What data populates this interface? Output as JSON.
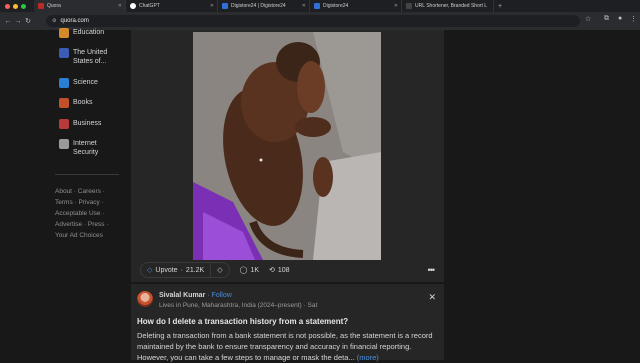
{
  "browser": {
    "tabs": [
      {
        "title": "Quora",
        "color": "#b92b27",
        "active": true
      },
      {
        "title": "ChatGPT",
        "color": "#ffffff",
        "active": false
      },
      {
        "title": "Digistore24 | Digistore24",
        "color": "#2f6fd6",
        "active": false
      },
      {
        "title": "Digistore24",
        "color": "#2f6fd6",
        "active": false
      },
      {
        "title": "URL Shortener, Branded Short Lin",
        "color": "#444444",
        "active": false
      }
    ],
    "new_tab_icon": "plus-icon",
    "url": "quora.com"
  },
  "sidebar": {
    "items": [
      {
        "label": "Education",
        "icon": "education-icon",
        "color": "#d48a2a"
      },
      {
        "label": "The United States of...",
        "icon": "us-flag-icon",
        "color": "#3b5bb5"
      },
      {
        "label": "Science",
        "icon": "science-icon",
        "color": "#2a7fd4"
      },
      {
        "label": "Books",
        "icon": "books-icon",
        "color": "#c2512a"
      },
      {
        "label": "Business",
        "icon": "business-icon",
        "color": "#b83a3a"
      },
      {
        "label": "Internet Security",
        "icon": "security-icon",
        "color": "#9a9a9a"
      }
    ],
    "footer": [
      "About",
      "Careers",
      "Terms",
      "Privacy",
      "Acceptable Use",
      "Advertise",
      "Press",
      "Your Ad Choices"
    ]
  },
  "answer_actions": {
    "upvote_label": "Upvote",
    "upvote_count": "21.2K",
    "comments": "1K",
    "shares": "108"
  },
  "second_answer": {
    "author": "Sivalal Kumar",
    "follow": "Follow",
    "credential": "Lives in Pune, Maharashtra, India (2024–present) · Sat",
    "question": "How do I delete a transaction history from a statement?",
    "body": "Deleting a transaction from a bank statement is not possible, as the statement is a record maintained by the bank to ensure transparency and accuracy in financial reporting. However, you can take a few steps to manage or mask the deta",
    "more_label": "(more)"
  },
  "colors": {
    "accent": "#4a8cd9",
    "background": "#181818",
    "card": "#262626"
  }
}
